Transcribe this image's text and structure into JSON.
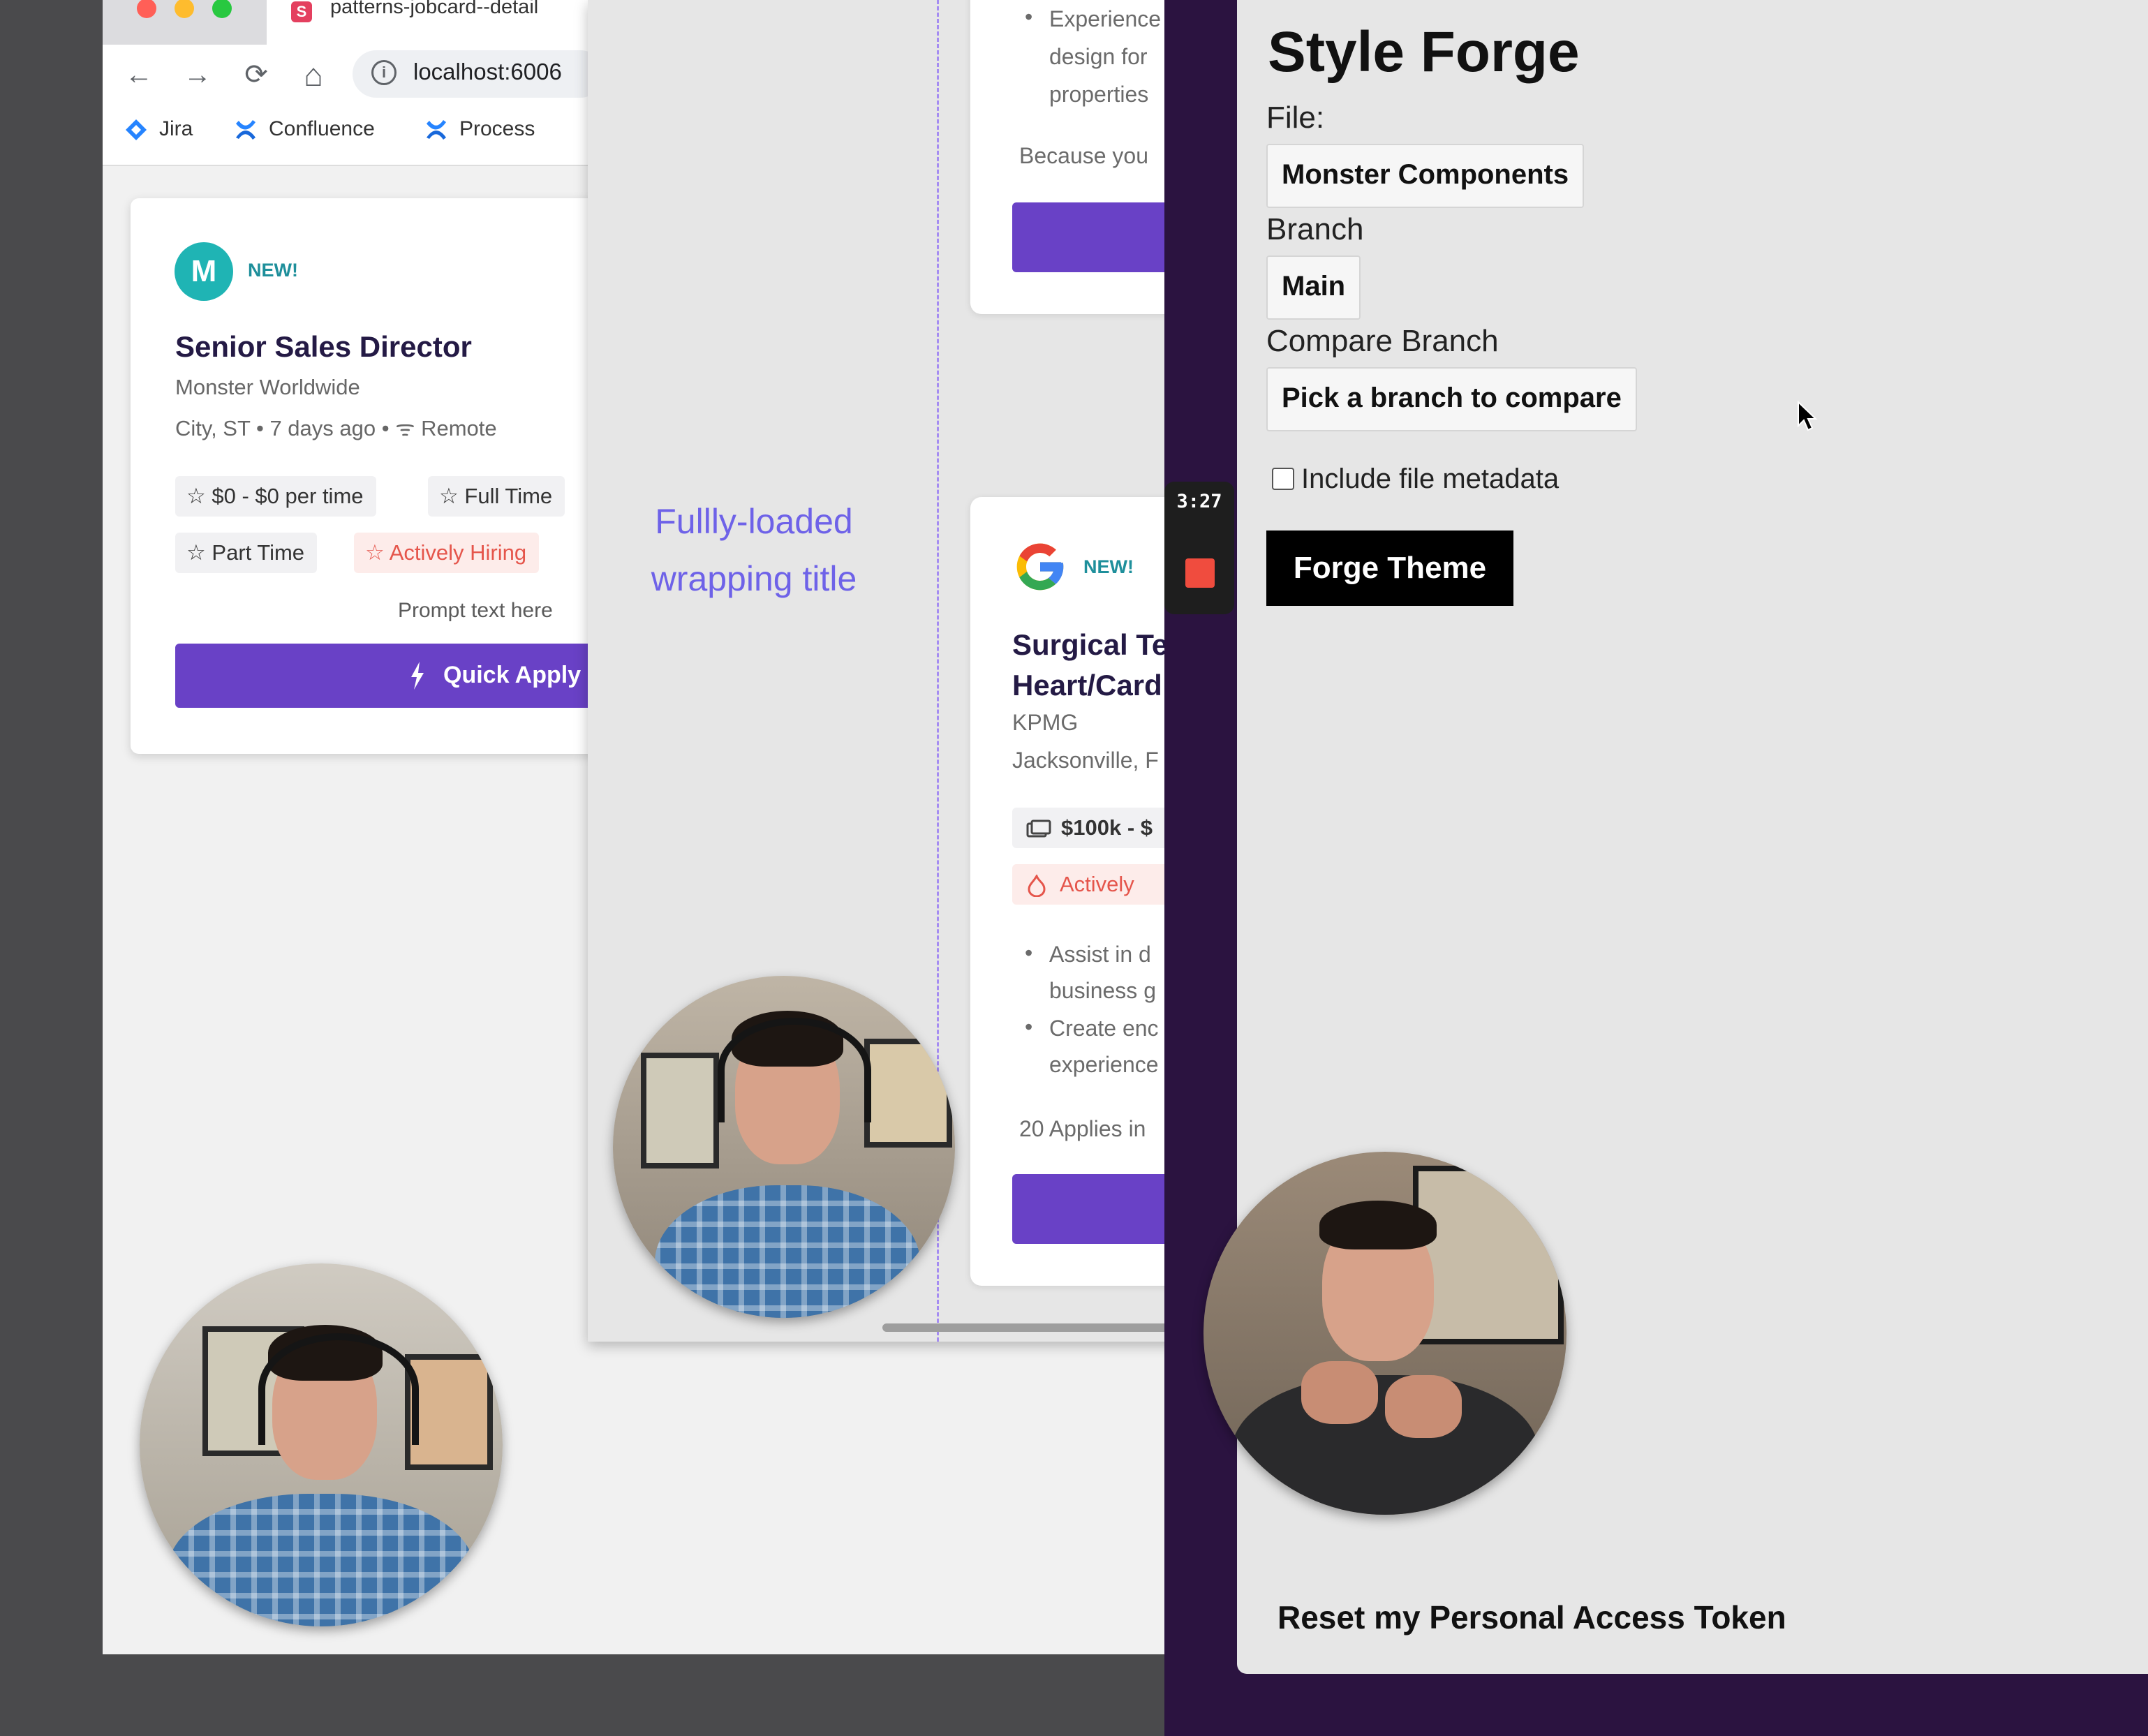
{
  "browser": {
    "tab_title": "patterns-jobcard--detail",
    "favicon_letter": "S",
    "url": "localhost:6006",
    "nav": {
      "back": "←",
      "forward": "→",
      "reload": "⟳",
      "home": "⌂",
      "info": "i"
    },
    "bookmarks": [
      {
        "label": "Jira",
        "icon": "jira-icon"
      },
      {
        "label": "Confluence",
        "icon": "confluence-icon"
      },
      {
        "label": "Process",
        "icon": "confluence-icon"
      }
    ]
  },
  "jobcard": {
    "logo_letter": "M",
    "badge": "NEW!",
    "title": "Senior Sales Director",
    "company": "Monster Worldwide",
    "meta": "City, ST  •  7 days ago  •  ᯤ Remote",
    "chips": [
      "☆ $0 - $0 per time",
      "☆ Full Time",
      "☆ Part Time",
      "☆ Actively Hiring"
    ],
    "prompt": "Prompt text here",
    "quick_apply": "Quick Apply",
    "quick_apply_icon": "lightning-icon"
  },
  "canvas": {
    "wrapping_title_line1": "Fullly-loaded",
    "wrapping_title_line2": "wrapping title",
    "top_card": {
      "bullet_lines": [
        "Experience",
        "design for",
        "properties"
      ],
      "footer": "Because you"
    },
    "google_card": {
      "badge": "NEW!",
      "title_line1": "Surgical Te",
      "title_line2": "Heart/Card",
      "company": "KPMG",
      "location": "Jacksonville, F",
      "chip_salary": "$100k - $",
      "chip_hiring": "Actively",
      "bullets": [
        [
          "Assist in d",
          "business g"
        ],
        [
          "Create enc",
          "experience"
        ]
      ],
      "applies": "20 Applies in"
    }
  },
  "recorder": {
    "time": "3:27"
  },
  "plugin": {
    "title": "Style Forge",
    "file_label": "File:",
    "file_value": "Monster Components",
    "branch_label": "Branch",
    "branch_value": "Main",
    "compare_label": "Compare Branch",
    "compare_value": "Pick a branch to compare",
    "metadata_label": "Include file metadata",
    "metadata_checked": false,
    "forge_button": "Forge Theme",
    "reset_link": "Reset my Personal Access Token"
  },
  "colors": {
    "primary_purple": "#6941c6",
    "teal": "#1fb4b4",
    "hot_red": "#e5554b",
    "canvas_title": "#6e62e8",
    "plugin_bg": "#e6e6e6",
    "desktop_purple": "#2b1340"
  }
}
